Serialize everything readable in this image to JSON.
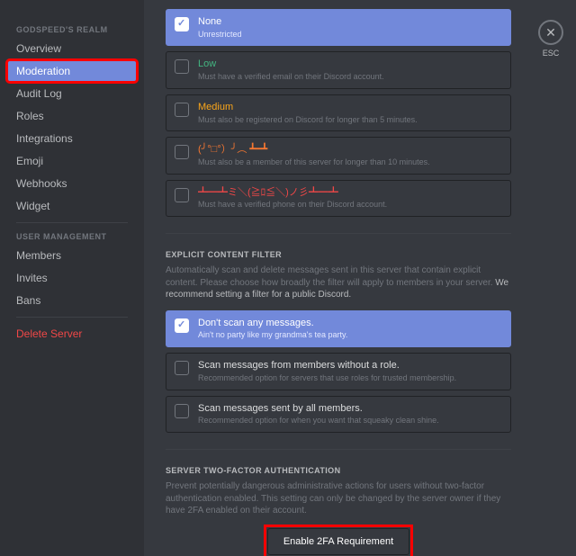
{
  "sidebar": {
    "server_heading": "GODSPEED'S REALM",
    "items_server": [
      "Overview",
      "Moderation",
      "Audit Log",
      "Roles",
      "Integrations",
      "Emoji",
      "Webhooks",
      "Widget"
    ],
    "user_heading": "USER MANAGEMENT",
    "items_user": [
      "Members",
      "Invites",
      "Bans"
    ],
    "delete": "Delete Server"
  },
  "esc_label": "ESC",
  "verification": {
    "options": [
      {
        "title": "None",
        "sub": "Unrestricted",
        "selected": true,
        "color": ""
      },
      {
        "title": "Low",
        "sub": "Must have a verified email on their Discord account.",
        "selected": false,
        "color": "green"
      },
      {
        "title": "Medium",
        "sub": "Must also be registered on Discord for longer than 5 minutes.",
        "selected": false,
        "color": "yellow"
      },
      {
        "title": "(╯°□°）╯︵ ┻━┻",
        "sub": "Must also be a member of this server for longer than 10 minutes.",
        "selected": false,
        "color": "orange"
      },
      {
        "title": "┻━┻ミ＼(≧ﾛ≦＼)ノ彡┻━┻",
        "sub": "Must have a verified phone on their Discord account.",
        "selected": false,
        "color": "red"
      }
    ]
  },
  "explicit": {
    "heading": "EXPLICIT CONTENT FILTER",
    "desc_a": "Automatically scan and delete messages sent in this server that contain explicit content. Please choose how broadly the filter will apply to members in your server. ",
    "desc_b": "We recommend setting a filter for a public Discord.",
    "options": [
      {
        "title": "Don't scan any messages.",
        "sub": "Ain't no party like my grandma's tea party.",
        "selected": true
      },
      {
        "title": "Scan messages from members without a role.",
        "sub": "Recommended option for servers that use roles for trusted membership.",
        "selected": false
      },
      {
        "title": "Scan messages sent by all members.",
        "sub": "Recommended option for when you want that squeaky clean shine.",
        "selected": false
      }
    ]
  },
  "twofa": {
    "heading": "SERVER TWO-FACTOR AUTHENTICATION",
    "desc": "Prevent potentially dangerous administrative actions for users without two-factor authentication enabled. This setting can only be changed by the server owner if they have 2FA enabled on their account.",
    "button": "Enable 2FA Requirement"
  }
}
